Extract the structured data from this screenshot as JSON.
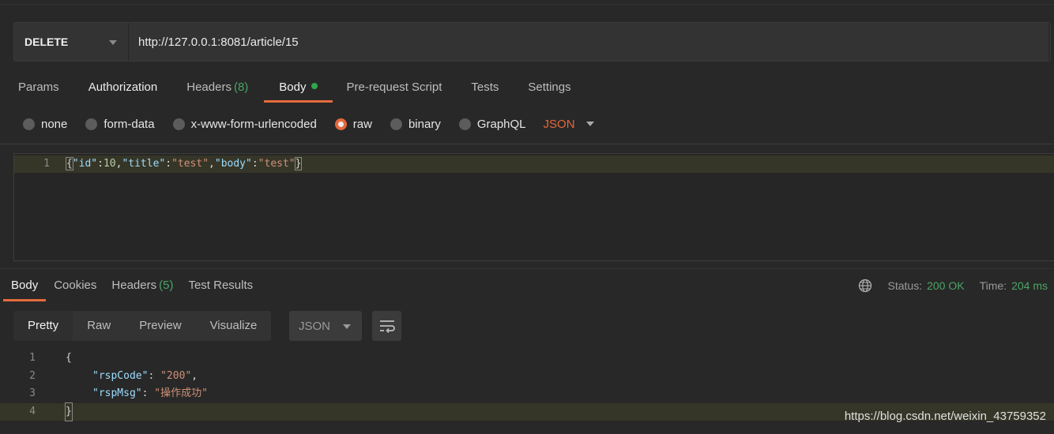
{
  "request": {
    "method": "DELETE",
    "url": "http://127.0.0.1:8081/article/15"
  },
  "request_tabs": {
    "params": "Params",
    "authorization": "Authorization",
    "headers": "Headers",
    "headers_count": "(8)",
    "body": "Body",
    "pre_request": "Pre-request Script",
    "tests": "Tests",
    "settings": "Settings"
  },
  "body_types": {
    "none": "none",
    "form_data": "form-data",
    "urlencoded": "x-www-form-urlencoded",
    "raw": "raw",
    "binary": "binary",
    "graphql": "GraphQL",
    "format": "JSON",
    "selected": "raw"
  },
  "request_body": {
    "line_number": "1",
    "open_brace": "{",
    "k1": "\"id\"",
    "colon1": ":",
    "v1": "10",
    "comma1": ",",
    "k2": "\"title\"",
    "colon2": ":",
    "v2": "\"test\"",
    "comma2": ",",
    "k3": "\"body\"",
    "colon3": ":",
    "v3": "\"test\"",
    "close_brace": "}"
  },
  "response_tabs": {
    "body": "Body",
    "cookies": "Cookies",
    "headers": "Headers",
    "headers_count": "(5)",
    "test_results": "Test Results"
  },
  "status": {
    "status_label": "Status:",
    "status_value": "200 OK",
    "time_label": "Time:",
    "time_value": "204 ms"
  },
  "view_modes": {
    "pretty": "Pretty",
    "raw": "Raw",
    "preview": "Preview",
    "visualize": "Visualize",
    "format": "JSON"
  },
  "response_body": {
    "lines": [
      {
        "num": "1",
        "text": "{"
      },
      {
        "num": "2",
        "key": "\"rspCode\"",
        "sep": ": ",
        "value": "\"200\"",
        "tail": ","
      },
      {
        "num": "3",
        "key": "\"rspMsg\"",
        "sep": ": ",
        "value": "\"操作成功\"",
        "tail": ""
      },
      {
        "num": "4",
        "text": "}"
      }
    ]
  },
  "watermark": "https://blog.csdn.net/weixin_43759352"
}
